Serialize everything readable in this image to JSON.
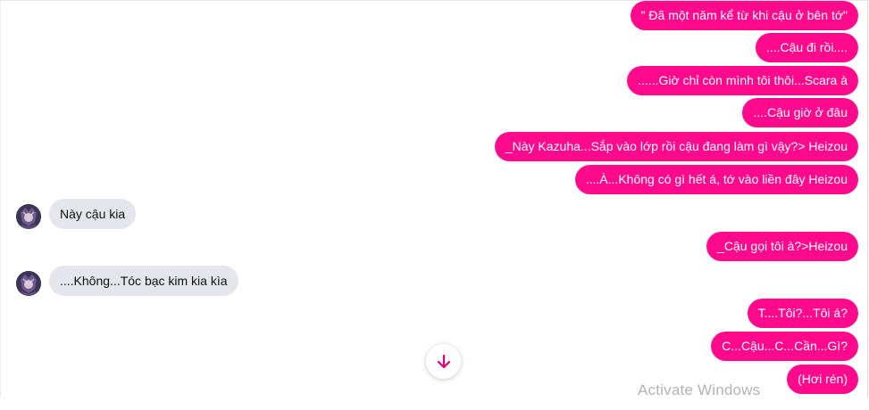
{
  "messages": {
    "m1": "\" Đã một năm kể từ khi cậu ở bên tớ\"",
    "m2": "....Cậu đi rồi....",
    "m3": "......Giờ chỉ còn mình tôi thôi...Scara à",
    "m4": "....Cậu giờ ở đâu",
    "m5": "_Này Kazuha...Sắp vào lớp rồi cậu đang làm gì vậy?> Heizou",
    "m6": "....À...Không có gì hết á, tớ vào liền đây Heizou",
    "m7": "Này cậu kia",
    "m8": "_Cậu gọi tôi à?>Heizou",
    "m9": "....Không...Tóc bạc kim kia kìa",
    "m10": "T....Tôi?...Tôi á?",
    "m11": "C...Cậu...C...Cần...Gì?",
    "m12": "(Hơi rén)"
  },
  "watermark": "Activate Windows",
  "colors": {
    "outgoing": "#ff0a8c",
    "incoming": "#e4e6eb",
    "scroll_arrow": "#e6006f"
  },
  "icons": {
    "scroll_down": "arrow-down-icon",
    "avatar": "user-avatar"
  }
}
